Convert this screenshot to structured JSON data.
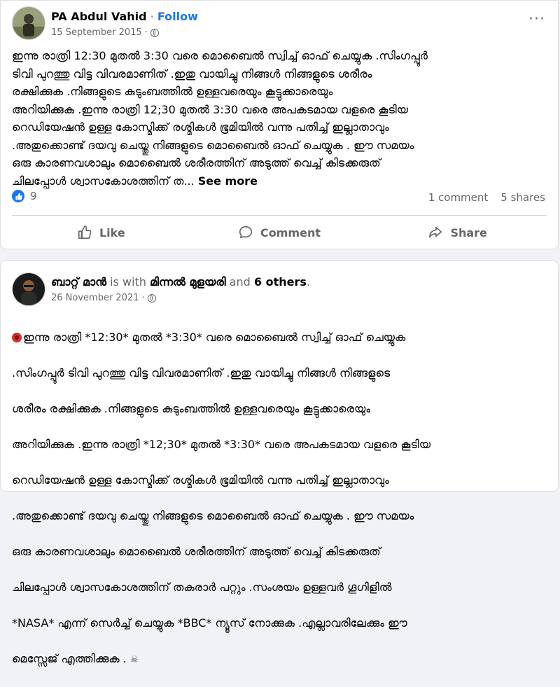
{
  "post1": {
    "author": "PA Abdul Vahid",
    "separator": "·",
    "follow": "Follow",
    "date": "15 September 2015",
    "meta_separator": "·",
    "text": "ഇന്നു രാത്രി 12:30 മുതൽ 3:30 വരെ മൊബൈൽ സ്വിച്ച് ഓഫ് ചെയ്യുക .സിംഗപ്പൂർ\nടിവി പുറത്തു വിട്ട വിവരമാണിത് .ഇതു വായിച്ചു നിങ്ങൾ നിങ്ങളുടെ ശരീരം\nരക്ഷിക്കുക .നിങ്ങളുടെ കുടുംബത്തിൽ ഉള്ളവരെയും കൂട്ടുക്കാരെയും\nഅറിയിക്കുക .ഇന്നു രാത്രി 12;30 മുതൽ 3:30 വരെ അപകടമായ വളരെ കൂടിയ\nറെഡിയേഷൻ ഉള്ള കോസ്മിക്ക് രശ്മികൾ ഭൂമിയിൽ വന്നു പതിച്ച് ഇല്ലാതാവും\n.അതുക്കൊണ്ട് ദയവു ചെയ്തു നിങ്ങളുടെ മൊബൈൽ ഓഫ് ചെയ്യുക . ഈ സമയം\nഒരു കാരണവശാലും മൊബൈൽ ശരീരത്തിന് അടുത്ത് വെച്ച് കിടക്കരുത്\nചിലപ്പോൾ ശ്വാസകോശത്തിന് ത...",
    "see_more": "See more",
    "reaction_count": "9",
    "comments": "1 comment",
    "shares": "5 shares",
    "actions": {
      "like": "Like",
      "comment": "Comment",
      "share": "Share"
    }
  },
  "post2": {
    "author": "ബാറ്റ് മാൻ",
    "is_with": "is with",
    "tagged": "മിന്നൽ മുളയരി",
    "and_text": "and",
    "others": "6 others",
    "period": ".",
    "date": "26 November 2021",
    "meta_separator": "·",
    "text_lines": [
      "ഇന്നു രാത്രി *12:30* മുതൽ *3:30* വരെ മൊബൈൽ സ്വിച്ച് ഓഫ് ചെയ്യുക",
      ".സിംഗപ്പൂർ ടിവി പുറത്തു വിട്ട വിവരമാണിത് .ഇതു വായിച്ചു നിങ്ങൾ നിങ്ങളുടെ",
      "ശരീരം രക്ഷിക്കുക .നിങ്ങളുടെ കുടുംബത്തിൽ ഉള്ളവരെയും കൂട്ടുക്കാരെയും",
      "അറിയിക്കുക .ഇന്നു രാത്രി *12;30* മുതൽ *3:30* വരെ അപകടമായ വളരെ കൂടിയ",
      "റെഡിയേഷൻ ഉള്ള കോസ്മിക്ക് രശ്മികൾ ഭൂമിയിൽ വന്നു പതിച്ച് ഇല്ലാതാവും",
      ".അതുക്കൊണ്ട് ദയവു ചെയ്തു നിങ്ങളുടെ മൊബൈൽ ഓഫ് ചെയ്യുക . ഈ സമയം",
      "ഒരു കാരണവശാലും മൊബൈൽ ശരീരത്തിന് അടുത്ത് വെച്ച് കിടക്കരുത്",
      "ചിലപ്പോൾ ശ്വാസകോശത്തിന് തകരാർ പറ്റും .സംശയം ഉള്ളവർ ഗൂഗിളിൽ",
      "*NASA* എന്ന് സെർച്ച് ചെയ്യുക *BBC* ന്യൂസ് നോക്കുക .എല്ലാവരിലേക്കും ഈ",
      "മെസ്സേജ് എത്തിക്കുക ."
    ],
    "end_icon": "skull-icon"
  },
  "colors": {
    "accent": "#1877f2",
    "muted": "#65676b",
    "background": "#f0f2f5"
  }
}
